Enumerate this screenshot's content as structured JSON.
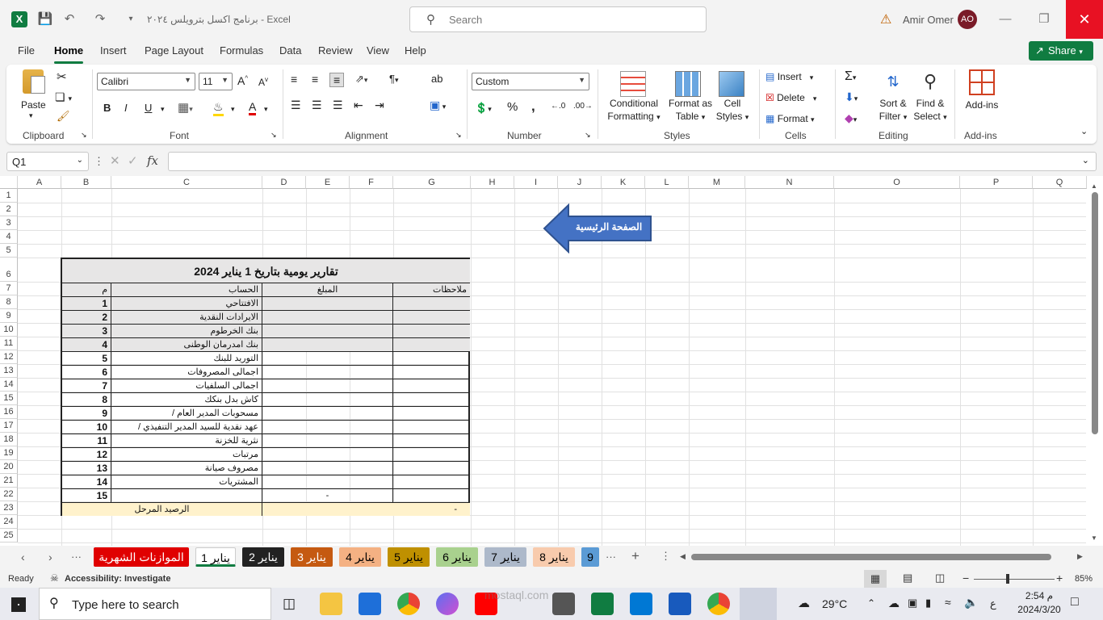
{
  "title": {
    "doc_title": "برنامج اكسل بترويلس ٢٠٢٤ - Excel",
    "search_placeholder": "Search",
    "user_name": "Amir Omer",
    "user_initials": "AO"
  },
  "menu": [
    "File",
    "Home",
    "Insert",
    "Page Layout",
    "Formulas",
    "Data",
    "Review",
    "View",
    "Help"
  ],
  "share_label": "Share",
  "ribbon": {
    "clipboard": {
      "paste": "Paste",
      "label": "Clipboard"
    },
    "font": {
      "name": "Calibri",
      "size": "11",
      "label": "Font",
      "bold": "B",
      "italic": "I",
      "underline": "U"
    },
    "alignment": {
      "label": "Alignment"
    },
    "number": {
      "format": "Custom",
      "label": "Number"
    },
    "styles": {
      "cond1": "Conditional",
      "cond2": "Formatting",
      "fmt1": "Format as",
      "fmt2": "Table",
      "cell1": "Cell",
      "cell2": "Styles",
      "label": "Styles"
    },
    "cells": {
      "insert": "Insert",
      "delete": "Delete",
      "format": "Format",
      "label": "Cells"
    },
    "editing": {
      "sort1": "Sort &",
      "sort2": "Filter",
      "find1": "Find &",
      "find2": "Select",
      "label": "Editing"
    },
    "addins": {
      "name": "Add-ins",
      "label": "Add-ins"
    }
  },
  "namebox": "Q1",
  "columns": [
    "A",
    "B",
    "C",
    "D",
    "E",
    "F",
    "G",
    "H",
    "I",
    "J",
    "K",
    "L",
    "M",
    "N",
    "O",
    "P",
    "Q"
  ],
  "rows": [
    "1",
    "2",
    "3",
    "4",
    "5",
    "6",
    "7",
    "8",
    "9",
    "10",
    "11",
    "12",
    "13",
    "14",
    "15",
    "16",
    "17",
    "18",
    "19",
    "20",
    "21",
    "22",
    "23",
    "24",
    "25"
  ],
  "arrow_label": "الصفحة الرئيسية",
  "report": {
    "title": "تقارير يومية  بتاريخ 1 يناير 2024",
    "headers": {
      "notes": "ملاحظات",
      "amount": "المبلغ",
      "account": "الحساب",
      "num": "م"
    },
    "rows": [
      {
        "num": "1",
        "account": "الافتتاحي",
        "amount": ""
      },
      {
        "num": "2",
        "account": "الايرادات النقدية",
        "amount": ""
      },
      {
        "num": "3",
        "account": "بنك الخرطوم",
        "amount": ""
      },
      {
        "num": "4",
        "account": "بنك امدرمان الوطنى",
        "amount": ""
      },
      {
        "num": "5",
        "account": "التوريد للبنك",
        "amount": ""
      },
      {
        "num": "6",
        "account": "اجمالى المصروفات",
        "amount": ""
      },
      {
        "num": "7",
        "account": "اجمالى السلفيات",
        "amount": ""
      },
      {
        "num": "8",
        "account": "كاش بدل بنكك",
        "amount": ""
      },
      {
        "num": "9",
        "account": "مسحوبات المدير العام /",
        "amount": ""
      },
      {
        "num": "10",
        "account": "عهد نقدية للسيد المدير التنفيذي /",
        "amount": ""
      },
      {
        "num": "11",
        "account": "نثرية للخزنة",
        "amount": ""
      },
      {
        "num": "12",
        "account": "مرتبات",
        "amount": ""
      },
      {
        "num": "13",
        "account": "مصروف صيانة",
        "amount": ""
      },
      {
        "num": "14",
        "account": "المشتريات",
        "amount": ""
      },
      {
        "num": "15",
        "account": "",
        "amount": "-"
      }
    ],
    "footer": {
      "label": "الرصيد المرحل",
      "value": "-"
    }
  },
  "sheets": [
    {
      "name": "الموازنات الشهرية",
      "color": "#e00000",
      "fg": "#ffffff"
    },
    {
      "name": "يناير 1",
      "color": "#ffffff",
      "fg": "#000000"
    },
    {
      "name": "يناير 2",
      "color": "#222222",
      "fg": "#ffffff"
    },
    {
      "name": "يناير 3",
      "color": "#c55a11",
      "fg": "#ffffff"
    },
    {
      "name": "يناير 4",
      "color": "#f4b183",
      "fg": "#000000"
    },
    {
      "name": "يناير 5",
      "color": "#bf9000",
      "fg": "#000000"
    },
    {
      "name": "يناير 6",
      "color": "#a9d18e",
      "fg": "#000000"
    },
    {
      "name": "يناير 7",
      "color": "#adb9ca",
      "fg": "#000000"
    },
    {
      "name": "يناير 8",
      "color": "#f8cbad",
      "fg": "#000000"
    },
    {
      "name": "9",
      "color": "#5b9bd5",
      "fg": "#000000"
    }
  ],
  "status": {
    "ready": "Ready",
    "accessibility": "Accessibility: Investigate",
    "zoom": "85%"
  },
  "taskbar": {
    "search": "Type here to search",
    "temp": "29°C",
    "time": "2:54 م",
    "date": "2024/3/20",
    "lang": "ع"
  },
  "watermark": "mostaql.com"
}
